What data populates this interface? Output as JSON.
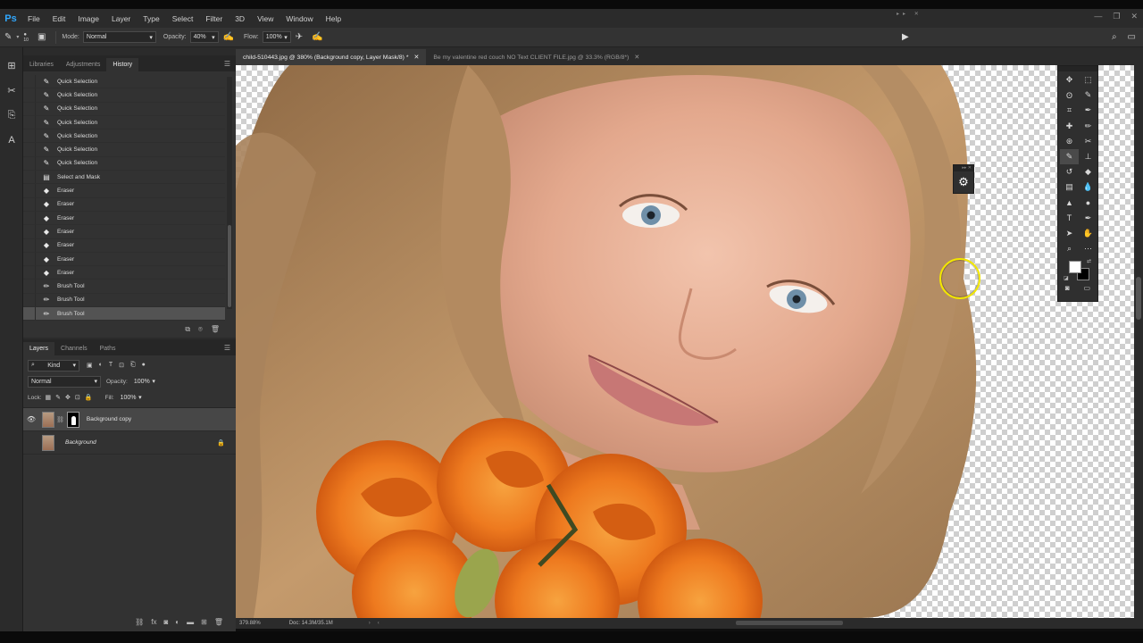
{
  "app": {
    "logo": "Ps"
  },
  "menu": [
    "File",
    "Edit",
    "Image",
    "Layer",
    "Type",
    "Select",
    "Filter",
    "3D",
    "View",
    "Window",
    "Help"
  ],
  "options": {
    "size": "10",
    "mode_label": "Mode:",
    "mode_value": "Normal",
    "opacity_label": "Opacity:",
    "opacity_value": "40%",
    "flow_label": "Flow:",
    "flow_value": "100%"
  },
  "top_panel_tabs": [
    "Libraries",
    "Adjustments",
    "History"
  ],
  "history": [
    {
      "label": "Quick Selection",
      "icon": "quick-selection-icon"
    },
    {
      "label": "Quick Selection",
      "icon": "quick-selection-icon"
    },
    {
      "label": "Quick Selection",
      "icon": "quick-selection-icon"
    },
    {
      "label": "Quick Selection",
      "icon": "quick-selection-icon"
    },
    {
      "label": "Quick Selection",
      "icon": "quick-selection-icon"
    },
    {
      "label": "Quick Selection",
      "icon": "quick-selection-icon"
    },
    {
      "label": "Quick Selection",
      "icon": "quick-selection-icon"
    },
    {
      "label": "Select and Mask",
      "icon": "select-mask-icon"
    },
    {
      "label": "Eraser",
      "icon": "eraser-icon"
    },
    {
      "label": "Eraser",
      "icon": "eraser-icon"
    },
    {
      "label": "Eraser",
      "icon": "eraser-icon"
    },
    {
      "label": "Eraser",
      "icon": "eraser-icon"
    },
    {
      "label": "Eraser",
      "icon": "eraser-icon"
    },
    {
      "label": "Eraser",
      "icon": "eraser-icon"
    },
    {
      "label": "Eraser",
      "icon": "eraser-icon"
    },
    {
      "label": "Brush Tool",
      "icon": "brush-icon"
    },
    {
      "label": "Brush Tool",
      "icon": "brush-icon"
    },
    {
      "label": "Brush Tool",
      "icon": "brush-icon",
      "selected": true
    }
  ],
  "layers_panel": {
    "tabs": [
      "Layers",
      "Channels",
      "Paths"
    ],
    "filter_kind": "Kind",
    "blend_mode": "Normal",
    "opacity_label": "Opacity:",
    "opacity_value": "100%",
    "lock_label": "Lock:",
    "fill_label": "Fill:",
    "fill_value": "100%",
    "layers": [
      {
        "name": "Background copy",
        "visible": true,
        "selected": true,
        "has_mask": true
      },
      {
        "name": "Background",
        "visible": false,
        "locked": true
      }
    ]
  },
  "doc_tabs": [
    {
      "title": "child-510443.jpg @ 380% (Background copy, Layer Mask/8) *",
      "active": true
    },
    {
      "title": "Be my valentine red couch NO Text CLIENT FILE.jpg @ 33.3% (RGB/8*)",
      "active": false
    }
  ],
  "status": {
    "zoom": "379.88%",
    "doc": "Doc: 14.3M/35.1M"
  },
  "colors": {
    "foreground": "#ffffff",
    "background": "#000000",
    "brush_cursor": "#f2e600",
    "accent": "#31a8ff"
  }
}
